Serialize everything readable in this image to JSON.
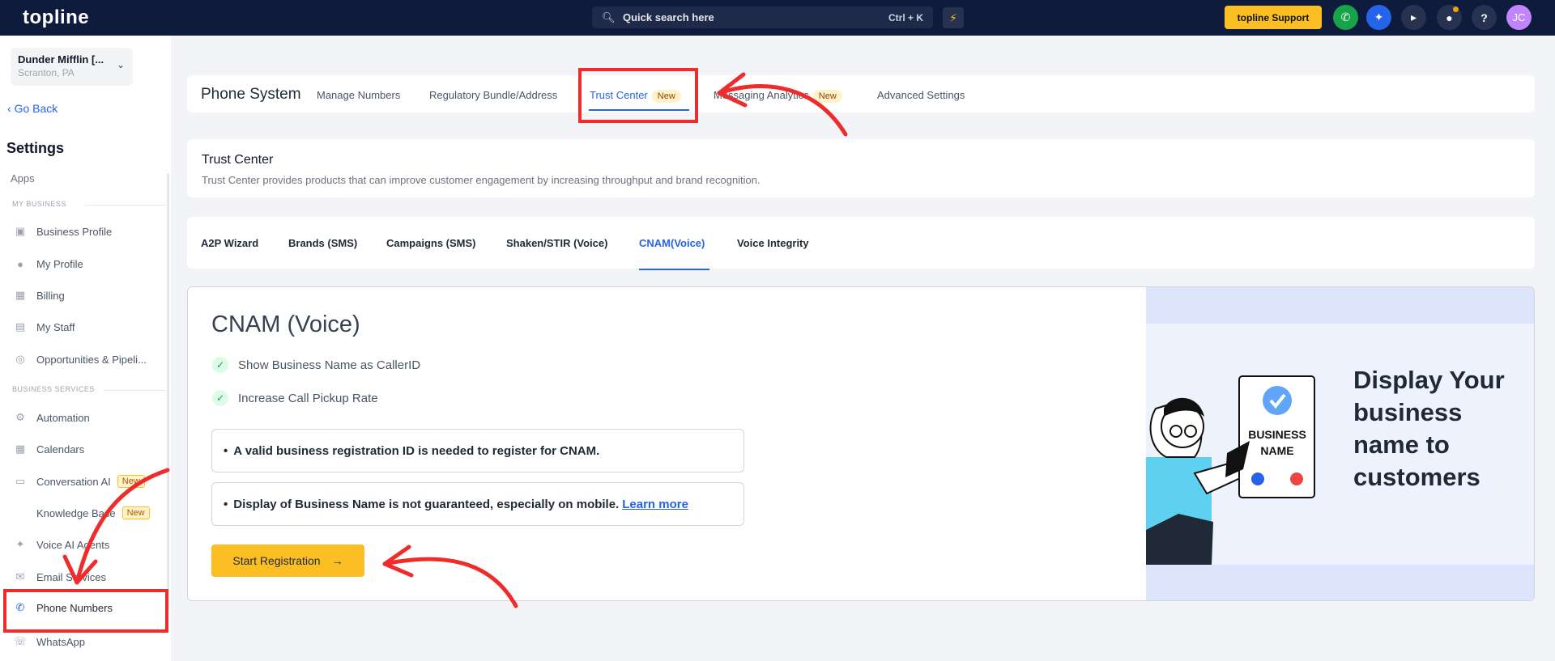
{
  "topbar": {
    "logo": "topline",
    "search_placeholder": "Quick search here",
    "search_shortcut": "Ctrl + K",
    "support_label": "topline Support",
    "avatar_initials": "JC"
  },
  "sidebar": {
    "location_name": "Dunder Mifflin [...",
    "location_city": "Scranton, PA",
    "go_back": "Go Back",
    "title": "Settings",
    "apps": "Apps",
    "section_my_business": "MY BUSINESS",
    "section_business_services": "BUSINESS SERVICES",
    "items": [
      {
        "label": "Business Profile"
      },
      {
        "label": "My Profile"
      },
      {
        "label": "Billing"
      },
      {
        "label": "My Staff"
      },
      {
        "label": "Opportunities & Pipeli..."
      },
      {
        "label": "Automation"
      },
      {
        "label": "Calendars"
      },
      {
        "label": "Conversation AI",
        "badge": "New"
      },
      {
        "label": "Knowledge Base",
        "badge": "New"
      },
      {
        "label": "Voice AI Agents"
      },
      {
        "label": "Email Services"
      },
      {
        "label": "Phone Numbers"
      },
      {
        "label": "WhatsApp"
      }
    ]
  },
  "phone_system": {
    "title": "Phone System",
    "tabs": [
      {
        "label": "Manage Numbers"
      },
      {
        "label": "Regulatory Bundle/Address"
      },
      {
        "label": "Trust Center",
        "badge": "New"
      },
      {
        "label": "Messaging Analytics",
        "badge": "New"
      },
      {
        "label": "Advanced Settings"
      }
    ]
  },
  "trust_center": {
    "title": "Trust Center",
    "description": "Trust Center provides products that can improve customer engagement by increasing throughput and brand recognition."
  },
  "sub_tabs": [
    {
      "label": "A2P Wizard"
    },
    {
      "label": "Brands (SMS)"
    },
    {
      "label": "Campaigns (SMS)"
    },
    {
      "label": "Shaken/STIR (Voice)"
    },
    {
      "label": "CNAM(Voice)"
    },
    {
      "label": "Voice Integrity"
    }
  ],
  "cnam": {
    "title": "CNAM (Voice)",
    "features": [
      "Show Business Name as CallerID",
      "Increase Call Pickup Rate"
    ],
    "note1": "A valid business registration ID is needed to register for CNAM.",
    "note2": "Display of Business Name is not guaranteed, especially on mobile.",
    "learn_more": "Learn more",
    "start_button": "Start Registration",
    "illustration_heading": "Display Your business name to customers",
    "phone_card_text": "BUSINESS NAME"
  },
  "colors": {
    "topbar": "#0f1b3d",
    "accent": "#2563eb",
    "button": "#fbbf24",
    "annotation": "#ef2b2b"
  }
}
